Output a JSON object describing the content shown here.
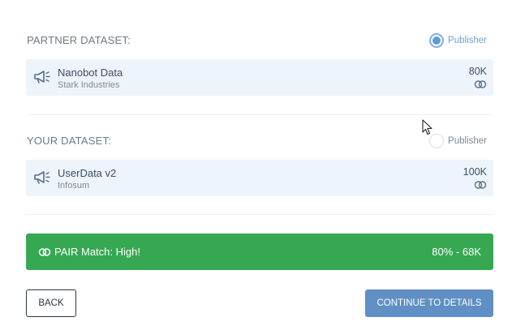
{
  "partner": {
    "section_label": "PARTNER DATASET:",
    "publisher_label": "Publisher",
    "publisher_selected": true,
    "dataset": {
      "name": "Nanobot Data",
      "org": "Stark Industries",
      "count": "80K",
      "icon": "megaphone-icon"
    }
  },
  "yours": {
    "section_label": "YOUR DATASET:",
    "publisher_label": "Publisher",
    "publisher_selected": false,
    "dataset": {
      "name": "UserData v2",
      "org": "Infosum",
      "count": "100K",
      "icon": "megaphone-icon"
    }
  },
  "match": {
    "label": "PAIR Match: High!",
    "score": "80% - 68K",
    "icon": "link-rings-icon",
    "color": "#36a852"
  },
  "buttons": {
    "back": "BACK",
    "continue": "CONTINUE TO DETAILS"
  },
  "colors": {
    "accent": "#5f8fc4",
    "card_bg": "#eef4fb"
  }
}
